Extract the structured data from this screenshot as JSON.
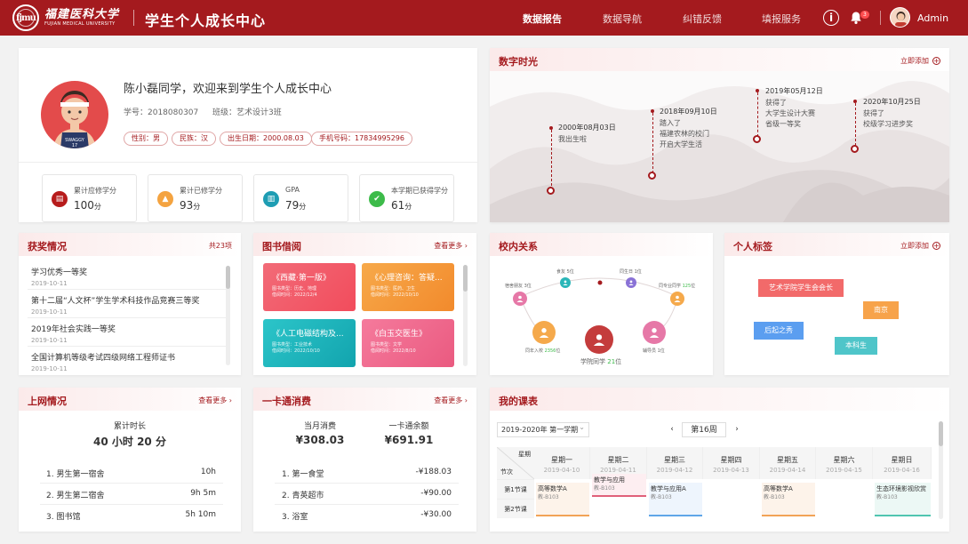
{
  "header": {
    "university_cn": "福建医科大学",
    "university_en": "FUJIAN MEDICAL UNIVERSITY",
    "logo_text": "fjmu",
    "app_title": "学生个人成长中心",
    "nav": [
      "数据报告",
      "数据导航",
      "纠错反馈",
      "填报服务"
    ],
    "notification_count": "3",
    "user": "Admin"
  },
  "profile": {
    "welcome": "陈小磊同学，欢迎来到学生个人成长中心",
    "student_id": "学号：2018080307",
    "class": "班级：艺术设计3班",
    "jersey": "SWAGGY",
    "jersey_no": "17",
    "tags": [
      "性别：男",
      "民族：汉",
      "出生日期：2000.08.03",
      "手机号码：17834995296"
    ],
    "stats": [
      {
        "label": "累计应修学分",
        "value": "100",
        "unit": "分",
        "color": "#b71c1c"
      },
      {
        "label": "累计已修学分",
        "value": "93",
        "unit": "分",
        "color": "#f4a340"
      },
      {
        "label": "GPA",
        "value": "79",
        "unit": "分",
        "color": "#1e9db3"
      },
      {
        "label": "本学期已获得学分",
        "value": "61",
        "unit": "分",
        "color": "#3dbb4a"
      }
    ]
  },
  "timeline": {
    "title": "数字时光",
    "add": "立即添加",
    "events": [
      {
        "date": "2000年08月03日",
        "text": [
          "我出生啦"
        ]
      },
      {
        "date": "2018年09月10日",
        "text": [
          "踏入了",
          "福建农林的校门",
          "开启大学生活"
        ]
      },
      {
        "date": "2019年05月12日",
        "text": [
          "获得了",
          "大学生设计大赛",
          "省级一等奖"
        ]
      },
      {
        "date": "2020年10月25日",
        "text": [
          "获得了",
          "校级学习进步奖"
        ]
      }
    ]
  },
  "awards": {
    "title": "获奖情况",
    "total": "共23项",
    "items": [
      {
        "name": "学习优秀一等奖",
        "date": "2019-10-11"
      },
      {
        "name": "第十二届“人文杯”学生学术科技作品竞赛三等奖",
        "date": "2019-10-11"
      },
      {
        "name": "2019年社会实践一等奖",
        "date": "2019-10-11"
      },
      {
        "name": "全国计算机等级考试四级网络工程师证书",
        "date": "2019-10-11"
      }
    ]
  },
  "books": {
    "title": "图书借阅",
    "more": "查看更多",
    "items": [
      {
        "title": "《西藏·第一版》",
        "type": "图书类型：历史、地理",
        "time": "借阅时间：2022/12/4",
        "color": "#f25c6a"
      },
      {
        "title": "《心理咨询：答疑...",
        "type": "图书类型：医药、卫生",
        "time": "借阅时间：2022/10/10",
        "color": "#f59a3c"
      },
      {
        "title": "《人工电磁结构及...",
        "type": "图书类型：工业技术",
        "time": "借阅时间：2022/10/10",
        "color": "#17b4b9"
      },
      {
        "title": "《白玉交医生》",
        "type": "图书类型：文学",
        "time": "借阅时间：2022/8/10",
        "color": "#ef6a8f"
      }
    ]
  },
  "relations": {
    "title": "校内关系",
    "nodes": [
      {
        "label": "学院同学",
        "value": "21",
        "unit": "位"
      },
      {
        "label": "同年入校",
        "value": "2356",
        "unit": "位"
      },
      {
        "label": "辅导员",
        "value": "1",
        "unit": "位"
      },
      {
        "label": "宿舍朋友",
        "value": "3",
        "unit": "位"
      },
      {
        "label": "食友",
        "value": "5",
        "unit": "位"
      },
      {
        "label": "同生日",
        "value": "1",
        "unit": "位"
      },
      {
        "label": "同专业同学",
        "value": "125",
        "unit": "位"
      }
    ]
  },
  "tags": {
    "title": "个人标签",
    "add": "立即添加",
    "items": [
      {
        "text": "艺术学院学生会会长",
        "color": "#f26a6a"
      },
      {
        "text": "南京",
        "color": "#f7a34a"
      },
      {
        "text": "后起之秀",
        "color": "#5b9ef0"
      },
      {
        "text": "本科生",
        "color": "#4fc5c9"
      }
    ]
  },
  "internet": {
    "title": "上网情况",
    "more": "查看更多",
    "total_label": "累计时长",
    "total_value": "40 小时 20 分",
    "rows": [
      {
        "name": "1. 男生第一宿舍",
        "value": "10h"
      },
      {
        "name": "2. 男生第二宿舍",
        "value": "9h 5m"
      },
      {
        "name": "3. 图书馆",
        "value": "5h 10m"
      }
    ]
  },
  "card": {
    "title": "一卡通消费",
    "more": "查看更多",
    "month_label": "当月消费",
    "month_value": "¥308.03",
    "balance_label": "一卡通余额",
    "balance_value": "¥691.91",
    "rows": [
      {
        "name": "1. 第一食堂",
        "value": "-¥188.03"
      },
      {
        "name": "2. 青英超市",
        "value": "-¥90.00"
      },
      {
        "name": "3. 浴室",
        "value": "-¥30.00"
      }
    ]
  },
  "schedule": {
    "title": "我的课表",
    "term": "2019-2020年 第一学期",
    "week": "第16周",
    "corner_day": "星期",
    "corner_slot": "节次",
    "days": [
      {
        "name": "星期一",
        "date": "2019-04-10"
      },
      {
        "name": "星期二",
        "date": "2019-04-11"
      },
      {
        "name": "星期三",
        "date": "2019-04-12"
      },
      {
        "name": "星期四",
        "date": "2019-04-13"
      },
      {
        "name": "星期五",
        "date": "2019-04-14"
      },
      {
        "name": "星期六",
        "date": "2019-04-15"
      },
      {
        "name": "星期日",
        "date": "2019-04-16"
      }
    ],
    "slots": [
      "第1节课",
      "第2节课"
    ],
    "courses": [
      {
        "day": 0,
        "name": "高等数学A",
        "room": "教-B103",
        "color": "#f2a356"
      },
      {
        "day": 1,
        "name": "教学与应用",
        "room": "教-B103",
        "color": "#e0607a"
      },
      {
        "day": 2,
        "name": "教学与应用A",
        "room": "教-B103",
        "color": "#5fa6e8"
      },
      {
        "day": 4,
        "name": "高等数学A",
        "room": "教-B103",
        "color": "#f2a356"
      },
      {
        "day": 6,
        "name": "生态环境影视欣赏",
        "room": "教-B103",
        "color": "#4fc5b0"
      }
    ]
  }
}
